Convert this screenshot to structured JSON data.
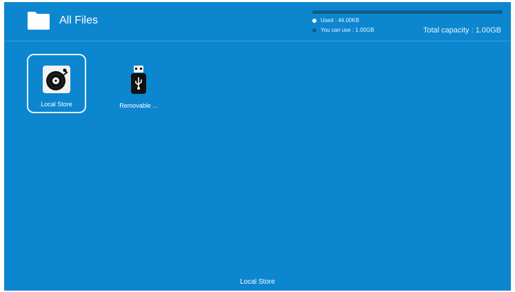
{
  "header": {
    "title": "All Files",
    "icon": "folder-icon"
  },
  "storage": {
    "used_label": "Used : 44.00KB",
    "free_label": "You can use : 1.00GB",
    "total_label": "Total capacity : 1.00GB",
    "used_fraction": 0.0,
    "used_color": "#ffffff",
    "free_color": "#0f5c8e"
  },
  "items": [
    {
      "label": "Local Store",
      "icon": "vinyl-record-icon",
      "selected": true
    },
    {
      "label": "Removable ...",
      "icon": "usb-drive-icon",
      "selected": false
    }
  ],
  "status_bar": {
    "text": "Local Store"
  },
  "colors": {
    "background": "#0d86d0",
    "text": "#ffffff"
  }
}
